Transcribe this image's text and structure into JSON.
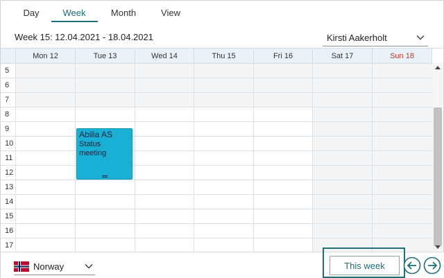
{
  "tabs": [
    {
      "label": "Day"
    },
    {
      "label": "Week"
    },
    {
      "label": "Month"
    },
    {
      "label": "View"
    }
  ],
  "active_tab": "Week",
  "header": {
    "week_title": "Week 15: 12.04.2021 - 18.04.2021",
    "user": "Kirsti Aakerholt"
  },
  "days": [
    {
      "label": "Mon 12"
    },
    {
      "label": "Tue 13"
    },
    {
      "label": "Wed 14"
    },
    {
      "label": "Thu 15"
    },
    {
      "label": "Fri 16"
    },
    {
      "label": "Sat 17"
    },
    {
      "label": "Sun 18"
    }
  ],
  "hours": [
    "5",
    "6",
    "7",
    "8",
    "9",
    "10",
    "11",
    "12",
    "13",
    "14",
    "15",
    "16",
    "17"
  ],
  "event": {
    "title": "Abilia AS",
    "subtitle": "Status meeting",
    "day": "Tue 13"
  },
  "footer": {
    "country": "Norway",
    "this_week_label": "This week"
  },
  "colors": {
    "accent": "#1f6f78",
    "event": "#1ab0d6",
    "sunday": "#c0392b",
    "header_bg": "#e8f2f8"
  },
  "icons": {
    "prev": "arrow-left-circle-icon",
    "next": "arrow-right-circle-icon",
    "dropdown": "chevron-down-icon",
    "flag": "norway-flag-icon"
  }
}
